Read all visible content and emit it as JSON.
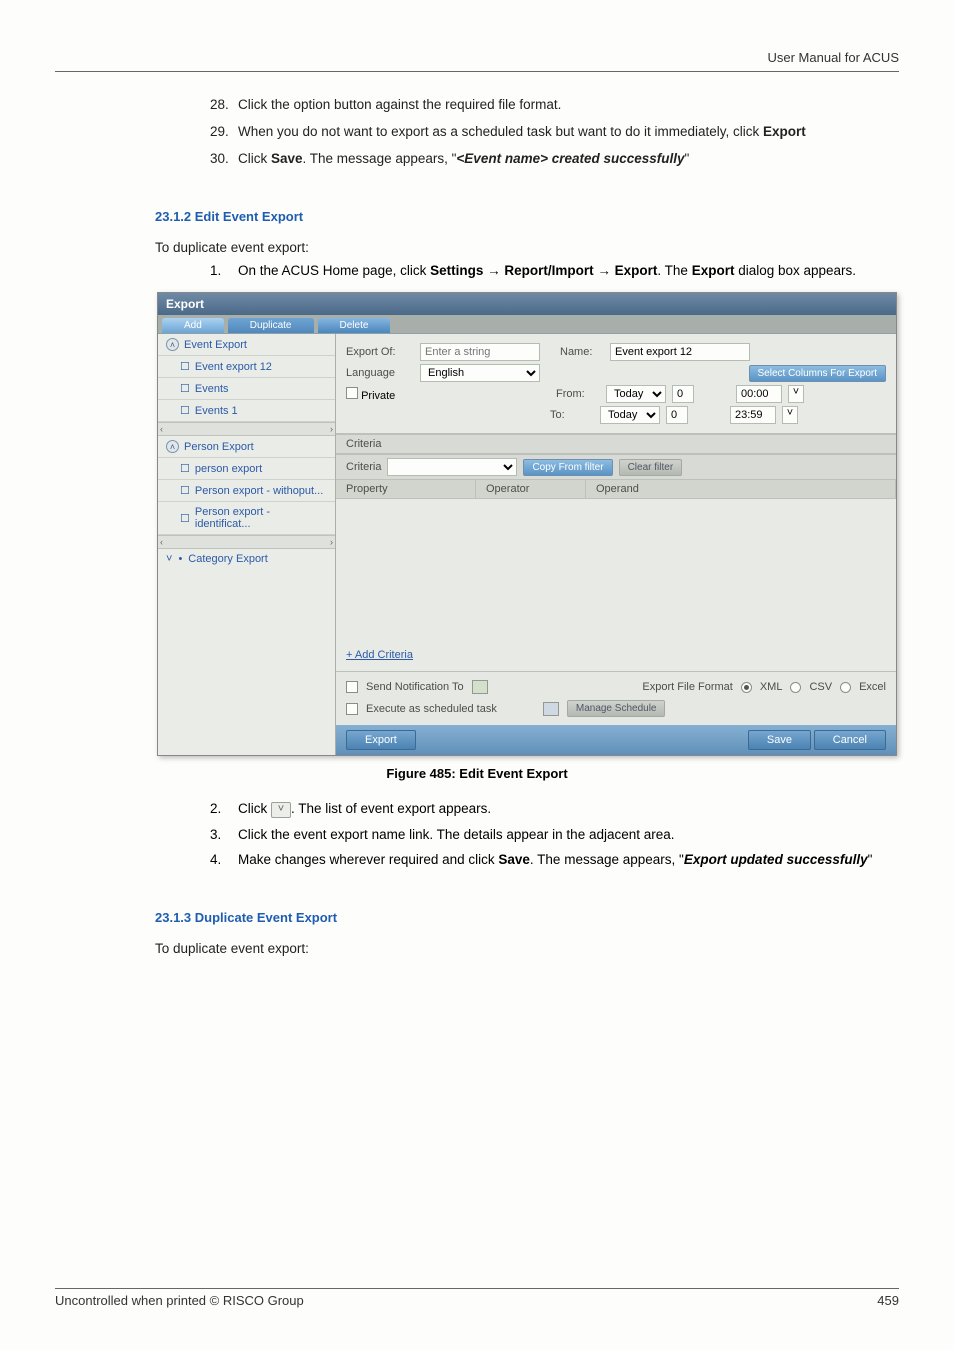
{
  "header": {
    "right_text": "User Manual for ACUS"
  },
  "top_steps": [
    {
      "num": "28.",
      "text": "Click the option button against the required file format."
    },
    {
      "num": "29.",
      "text_parts": [
        "When you do not want to export as a scheduled task but want to do it immediately, click ",
        {
          "bold": "Export"
        }
      ]
    },
    {
      "num": "30.",
      "text_parts": [
        "Click ",
        {
          "bold": "Save"
        },
        ". The message appears, \"",
        {
          "bolditalic": "<Event name> created successfully"
        },
        "\""
      ]
    }
  ],
  "sec1": {
    "heading": "23.1.2   Edit Event Export",
    "intro": "To duplicate event export:",
    "step1_parts": [
      "On the ACUS Home page, click ",
      {
        "bold": "Settings"
      },
      " → ",
      {
        "bold": "Report/Import"
      },
      " → ",
      {
        "bold": "Export"
      },
      ". The ",
      {
        "bold": "Export"
      },
      " dialog box appears."
    ]
  },
  "screenshot": {
    "window_title": "Export",
    "tabs": {
      "add": "Add",
      "duplicate": "Duplicate",
      "delete": "Delete"
    },
    "tree": {
      "root_event": "Event Export",
      "items_event": [
        "Event export 12",
        "Events",
        "Events 1"
      ],
      "root_person": "Person Export",
      "items_person": [
        "person export",
        "Person export - withoput...",
        "Person export - identificat..."
      ],
      "category": "Category Export"
    },
    "form": {
      "export_of_label": "Export Of:",
      "export_of_placeholder": "Enter a string",
      "name_label": "Name:",
      "name_value": "Event export 12",
      "language_label": "Language",
      "language_value": "English",
      "select_columns_btn": "Select Columns For Export",
      "private_label": "Private",
      "from_label": "From:",
      "to_label": "To:",
      "from_day": "Today",
      "from_day_offset": "0",
      "from_time": "00:00",
      "to_day": "Today",
      "to_day_offset": "0",
      "to_time": "23:59"
    },
    "criteria": {
      "section_label": "Criteria",
      "criteria_label": "Criteria",
      "copy_from_btn": "Copy From filter",
      "clear_btn": "Clear filter",
      "col_property": "Property",
      "col_operator": "Operator",
      "col_operand": "Operand",
      "add_link": "+ Add Criteria"
    },
    "opts": {
      "send_notif": "Send Notification To",
      "exec_sched": "Execute as scheduled task",
      "manage_sched_btn": "Manage Schedule",
      "fmt_label": "Export File Format",
      "fmt_xml": "XML",
      "fmt_csv": "CSV",
      "fmt_excel": "Excel"
    },
    "buttons": {
      "export": "Export",
      "save": "Save",
      "cancel": "Cancel"
    }
  },
  "figure_caption": "Figure 485: Edit Event Export",
  "sec1_steps_rest": [
    {
      "num": "2.",
      "parts": [
        "Click ",
        {
          "icon": "chevron-down"
        },
        ". The list of event export appears."
      ]
    },
    {
      "num": "3.",
      "parts": [
        "Click the event export name link. The details appear in the adjacent area."
      ]
    },
    {
      "num": "4.",
      "parts": [
        "Make changes wherever required and click ",
        {
          "bold": "Save"
        },
        ". The message appears, \"",
        {
          "bolditalic": "Export updated successfully"
        },
        "\""
      ]
    }
  ],
  "sec2": {
    "heading": "23.1.3   Duplicate Event Export",
    "intro": "To duplicate event export:"
  },
  "footer": {
    "left": "Uncontrolled when printed © RISCO Group",
    "right": "459"
  }
}
